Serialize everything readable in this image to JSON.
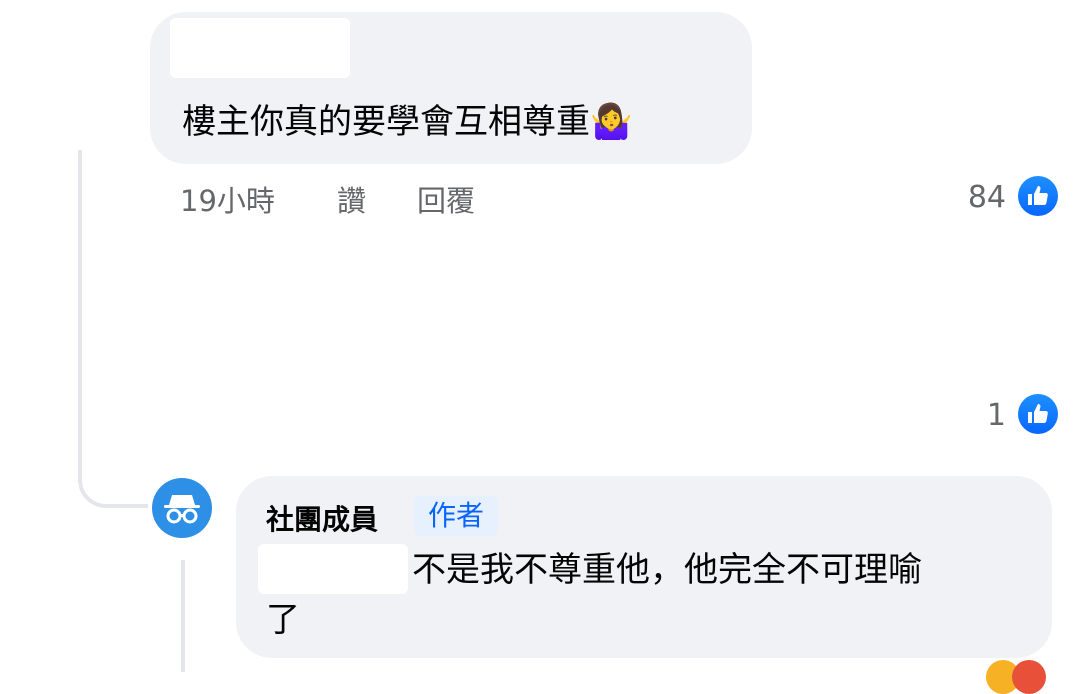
{
  "comment_1": {
    "text": "樓主你真的要學會互相尊重",
    "emoji": "🤷‍♀️",
    "time": "19小時",
    "like_action": "讚",
    "reply_action": "回覆",
    "like_count": "84"
  },
  "comment_2": {
    "like_count": "1"
  },
  "reply": {
    "author": "社團成員",
    "badge": "作者",
    "text_line1": "不是我不尊重他，他完全不可理喻",
    "text_line2": "了"
  },
  "colors": {
    "bubble": "#f0f2f5",
    "like_blue": "#0866ff",
    "meta_gray": "#65676b",
    "avatar_blue": "#2e8fe6"
  },
  "icons": {
    "like": "thumbs-up-icon",
    "avatar": "anonymous-member-icon"
  }
}
